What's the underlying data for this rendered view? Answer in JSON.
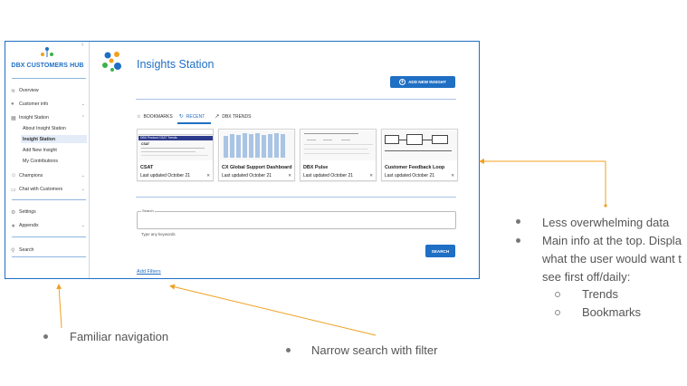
{
  "sidebar": {
    "title": "DBX CUSTOMERS HUB",
    "items": [
      {
        "label": "Overview",
        "icon": "wifi-icon"
      },
      {
        "label": "Customer info",
        "icon": "person-icon"
      },
      {
        "label": "Insight Station",
        "icon": "grid-icon"
      },
      {
        "label": "Champions",
        "icon": "smile-icon"
      },
      {
        "label": "Chat with Customers",
        "icon": "chat-icon"
      },
      {
        "label": "Settings",
        "icon": "gear-icon"
      },
      {
        "label": "Appendix",
        "icon": "star-icon"
      }
    ],
    "subitems": [
      "About Insight Station",
      "Insight Station",
      "Add New Insight",
      "My Contributions"
    ],
    "search_label": "Search"
  },
  "main": {
    "title": "Insights Station",
    "add_button": "ADD NEW INSIGHT",
    "tabs": [
      "BOOKMARKS",
      "RECENT",
      "DBX TRENDS"
    ],
    "cards": [
      {
        "title": "CSAT",
        "updated": "Last updated October 21",
        "thumb_header": "DBX Product CSAT Trends",
        "thumb_label": "CSAT"
      },
      {
        "title": "CX Global Support Dashboard",
        "updated": "Last updated October 21"
      },
      {
        "title": "DBX Pulse",
        "updated": "Last updated October 21"
      },
      {
        "title": "Customer Feedback Loop",
        "updated": "Last updated October 21"
      }
    ],
    "search": {
      "label": "Search",
      "hint": "Type any keywords",
      "button": "SEARCH"
    },
    "add_filters": "Add Filters"
  },
  "annotations": {
    "right_bullets": [
      "Less overwhelming data",
      "Main info at the top. Displa",
      "what the user would want t",
      "see first off/daily:"
    ],
    "right_sub": [
      "Trends",
      "Bookmarks"
    ],
    "nav_note": "Familiar navigation",
    "search_note": "Narrow search with filter"
  },
  "colors": {
    "accent": "#1f6fc4",
    "arrow": "#f0a020"
  }
}
